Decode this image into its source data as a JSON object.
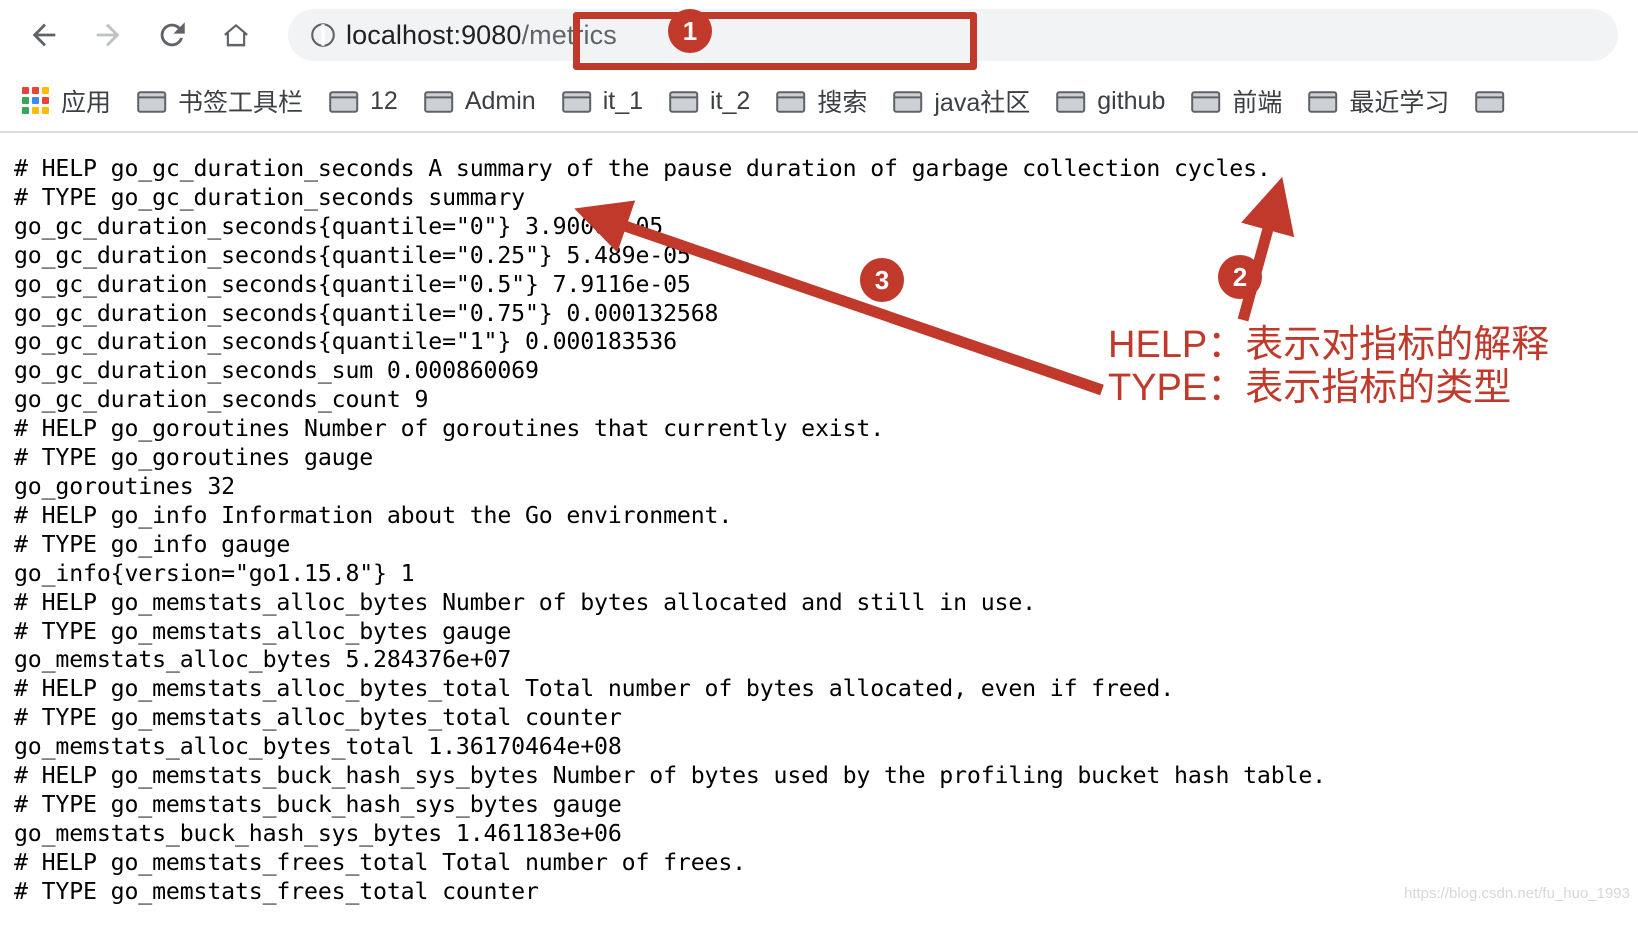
{
  "browser": {
    "nav": {
      "back": "back-arrow",
      "forward": "forward-arrow",
      "reload": "reload",
      "home": "home"
    },
    "omnibox": {
      "icon": "page-info-icon",
      "host": "localhost:9080",
      "path": "/metrics",
      "full_url": "localhost:9080/metrics"
    },
    "bookmarks": [
      {
        "icon": "apps-grid-icon",
        "label": "应用"
      },
      {
        "icon": "folder-icon",
        "label": "书签工具栏"
      },
      {
        "icon": "folder-icon",
        "label": "12"
      },
      {
        "icon": "folder-icon",
        "label": "Admin"
      },
      {
        "icon": "folder-icon",
        "label": "it_1"
      },
      {
        "icon": "folder-icon",
        "label": "it_2"
      },
      {
        "icon": "folder-icon",
        "label": "搜索"
      },
      {
        "icon": "folder-icon",
        "label": "java社区"
      },
      {
        "icon": "folder-icon",
        "label": "github"
      },
      {
        "icon": "folder-icon",
        "label": "前端"
      },
      {
        "icon": "folder-icon",
        "label": "最近学习"
      },
      {
        "icon": "folder-icon",
        "label": ""
      }
    ]
  },
  "page_content": {
    "metrics_text": "# HELP go_gc_duration_seconds A summary of the pause duration of garbage collection cycles.\n# TYPE go_gc_duration_seconds summary\ngo_gc_duration_seconds{quantile=\"0\"} 3.9006e-05\ngo_gc_duration_seconds{quantile=\"0.25\"} 5.489e-05\ngo_gc_duration_seconds{quantile=\"0.5\"} 7.9116e-05\ngo_gc_duration_seconds{quantile=\"0.75\"} 0.000132568\ngo_gc_duration_seconds{quantile=\"1\"} 0.000183536\ngo_gc_duration_seconds_sum 0.000860069\ngo_gc_duration_seconds_count 9\n# HELP go_goroutines Number of goroutines that currently exist.\n# TYPE go_goroutines gauge\ngo_goroutines 32\n# HELP go_info Information about the Go environment.\n# TYPE go_info gauge\ngo_info{version=\"go1.15.8\"} 1\n# HELP go_memstats_alloc_bytes Number of bytes allocated and still in use.\n# TYPE go_memstats_alloc_bytes gauge\ngo_memstats_alloc_bytes 5.284376e+07\n# HELP go_memstats_alloc_bytes_total Total number of bytes allocated, even if freed.\n# TYPE go_memstats_alloc_bytes_total counter\ngo_memstats_alloc_bytes_total 1.36170464e+08\n# HELP go_memstats_buck_hash_sys_bytes Number of bytes used by the profiling bucket hash table.\n# TYPE go_memstats_buck_hash_sys_bytes gauge\ngo_memstats_buck_hash_sys_bytes 1.461183e+06\n# HELP go_memstats_frees_total Total number of frees.\n# TYPE go_memstats_frees_total counter"
  },
  "annotations": {
    "accent_color": "#c0392b",
    "badges": [
      {
        "id": "1",
        "label": "1"
      },
      {
        "id": "2",
        "label": "2"
      },
      {
        "id": "3",
        "label": "3"
      }
    ],
    "notes": {
      "help": "HELP：表示对指标的解释",
      "type": "TYPE：表示指标的类型"
    }
  },
  "watermark": "https://blog.csdn.net/fu_huo_1993"
}
